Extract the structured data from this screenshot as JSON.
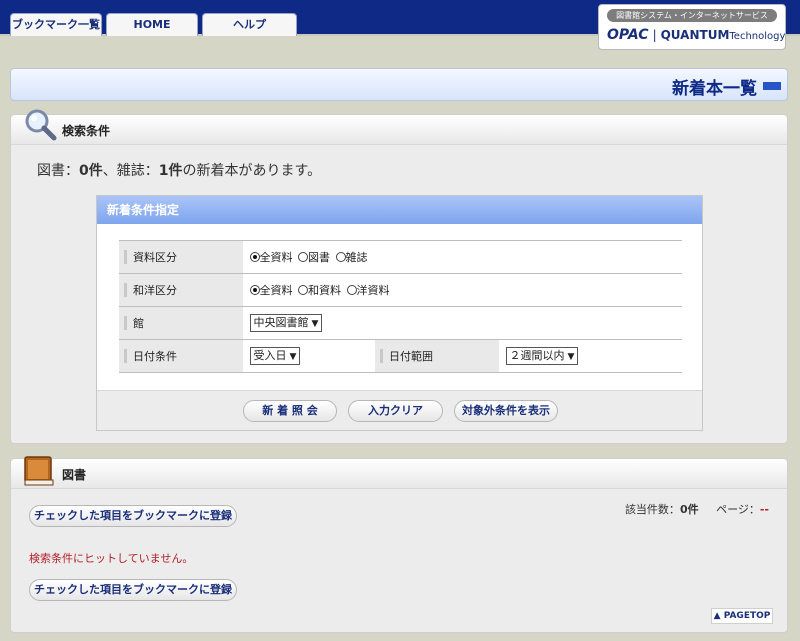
{
  "nav": {
    "tabs": [
      {
        "label": "ブックマーク一覧"
      },
      {
        "label": "HOME"
      },
      {
        "label": "ヘルプ"
      }
    ]
  },
  "brand": {
    "subtitle": "図書館システム・インターネットサービス",
    "opac": "OPAC",
    "separator": "|",
    "quantum": "QUANTUM",
    "technology": "Technology"
  },
  "page": {
    "title": "新着本一覧"
  },
  "search_section": {
    "header": "検索条件",
    "summary": {
      "prefix": "図書：",
      "books": "0件",
      "middle": "、雑誌：",
      "magazines": "1件",
      "suffix": "の新着本があります。"
    },
    "conditions": {
      "title": "新着条件指定",
      "rows": {
        "material": {
          "label": "資料区分",
          "options": [
            "全資料",
            "図書",
            "雑誌"
          ],
          "selected": "全資料"
        },
        "language": {
          "label": "和洋区分",
          "options": [
            "全資料",
            "和資料",
            "洋資料"
          ],
          "selected": "全資料"
        },
        "library": {
          "label": "館",
          "selected": "中央図書館"
        },
        "date": {
          "label": "日付条件",
          "selected": "受入日",
          "range_label": "日付範囲",
          "range_selected": "２週間以内"
        }
      },
      "buttons": {
        "search": "新 着 照 会",
        "clear": "入力クリア",
        "show_excluded": "対象外条件を表示"
      }
    }
  },
  "books_section": {
    "header": "図書",
    "bookmark_button": "チェックした項目をブックマークに登録",
    "count_label": "該当件数：",
    "count_value": "0件",
    "page_label": "ページ：",
    "page_value": "--",
    "no_hit": "検索条件にヒットしていません。",
    "pagetop": "▲ PAGETOP"
  }
}
